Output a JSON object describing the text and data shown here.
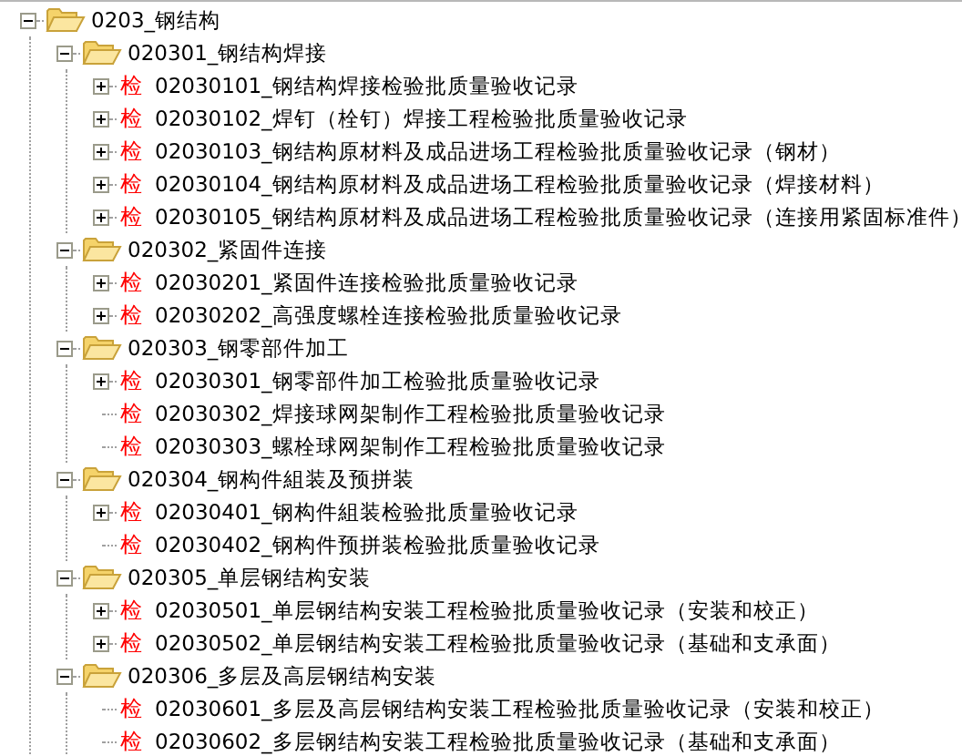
{
  "tree": [
    {
      "kind": "folder",
      "label": "0203_钢结构",
      "expandable": true,
      "expanded": true,
      "children": [
        {
          "kind": "folder",
          "label": "020301_钢结构焊接",
          "expandable": true,
          "expanded": true,
          "children": [
            {
              "kind": "form",
              "icon": "检",
              "label": "02030101_钢结构焊接检验批质量验收记录",
              "expandable": true,
              "expanded": false
            },
            {
              "kind": "form",
              "icon": "检",
              "label": "02030102_焊钉（栓钉）焊接工程检验批质量验收记录",
              "expandable": true,
              "expanded": false
            },
            {
              "kind": "form",
              "icon": "检",
              "label": "02030103_钢结构原材料及成品进场工程检验批质量验收记录（钢材）",
              "expandable": true,
              "expanded": false
            },
            {
              "kind": "form",
              "icon": "检",
              "label": "02030104_钢结构原材料及成品进场工程检验批质量验收记录（焊接材料）",
              "expandable": true,
              "expanded": false
            },
            {
              "kind": "form",
              "icon": "检",
              "label": "02030105_钢结构原材料及成品进场工程检验批质量验收记录（连接用紧固标准件）",
              "expandable": true,
              "expanded": false
            }
          ]
        },
        {
          "kind": "folder",
          "label": "020302_紧固件连接",
          "expandable": true,
          "expanded": true,
          "children": [
            {
              "kind": "form",
              "icon": "检",
              "label": "02030201_紧固件连接检验批质量验收记录",
              "expandable": true,
              "expanded": false
            },
            {
              "kind": "form",
              "icon": "检",
              "label": "02030202_高强度螺栓连接检验批质量验收记录",
              "expandable": true,
              "expanded": false
            }
          ]
        },
        {
          "kind": "folder",
          "label": "020303_钢零部件加工",
          "expandable": true,
          "expanded": true,
          "children": [
            {
              "kind": "form",
              "icon": "检",
              "label": "02030301_钢零部件加工检验批质量验收记录",
              "expandable": true,
              "expanded": false
            },
            {
              "kind": "form",
              "icon": "检",
              "label": "02030302_焊接球网架制作工程检验批质量验收记录",
              "expandable": false
            },
            {
              "kind": "form",
              "icon": "检",
              "label": "02030303_螺栓球网架制作工程检验批质量验收记录",
              "expandable": false
            }
          ]
        },
        {
          "kind": "folder",
          "label": "020304_钢构件組装及预拼装",
          "expandable": true,
          "expanded": true,
          "children": [
            {
              "kind": "form",
              "icon": "检",
              "label": "02030401_钢构件組装检验批质量验收记录",
              "expandable": true,
              "expanded": false
            },
            {
              "kind": "form",
              "icon": "检",
              "label": "02030402_钢构件预拼装检验批质量验收记录",
              "expandable": false
            }
          ]
        },
        {
          "kind": "folder",
          "label": "020305_单层钢结构安装",
          "expandable": true,
          "expanded": true,
          "children": [
            {
              "kind": "form",
              "icon": "检",
              "label": "02030501_单层钢结构安装工程检验批质量验收记录（安装和校正）",
              "expandable": true,
              "expanded": false
            },
            {
              "kind": "form",
              "icon": "检",
              "label": "02030502_单层钢结构安装工程检验批质量验收记录（基础和支承面）",
              "expandable": true,
              "expanded": false
            }
          ]
        },
        {
          "kind": "folder",
          "label": "020306_多层及高层钢结构安装",
          "expandable": true,
          "expanded": true,
          "children": [
            {
              "kind": "form",
              "icon": "检",
              "label": "02030601_多层及高层钢结构安装工程检验批质量验收记录（安装和校正）",
              "expandable": false
            },
            {
              "kind": "form",
              "icon": "检",
              "label": "02030602_多层钢结构安装工程检验批质量验收记录（基础和支承面）",
              "expandable": false
            }
          ]
        }
      ]
    }
  ]
}
